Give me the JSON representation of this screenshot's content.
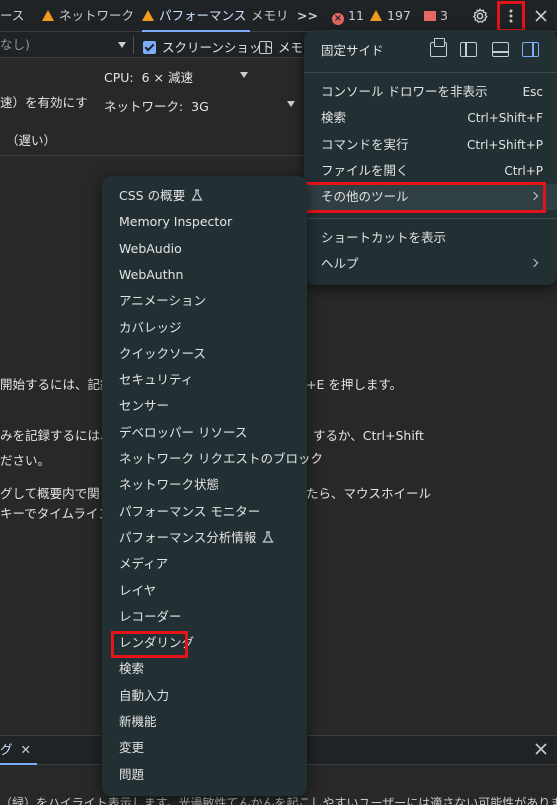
{
  "tabbar": {
    "tab_partial": "ース",
    "tab_network": "ネットワーク",
    "tab_performance": "パフォーマンス",
    "tab_memory": "メモリ",
    "more_tabs": ">>",
    "errors_count": "11",
    "warnings_count": "197",
    "issues_count": "3"
  },
  "toolbar": {
    "select_value": "なし)",
    "screenshot_label": "スクリーンショット",
    "memory_label": "メモリ"
  },
  "settings": {
    "left_text": "速）を有効にす",
    "cpu_label": "CPU:",
    "cpu_value": "6 × 減速",
    "network_label": "ネットワーク:",
    "network_value": "3G",
    "slow_text": "（遅い）"
  },
  "background_text": [
    "開始するには、記録",
    "+E を押します。",
    "みを記録するには、",
    "するか、Ctrl+Shift",
    "ださい。",
    "グして概要内で関",
    "たら、マウスホイール",
    "キーでタイムライン(",
    "（緑）をハイライト表示します。光過敏性てんかんを起こしやすいユーザーには適さない可能性があります"
  ],
  "drawer": {
    "tab_label": "グ",
    "close_label": "✕"
  },
  "main_menu": {
    "dock_side_label": "固定サイド",
    "items": [
      {
        "label": "コンソール ドロワーを非表示",
        "shortcut": "Esc"
      },
      {
        "label": "検索",
        "shortcut": "Ctrl+Shift+F"
      },
      {
        "label": "コマンドを実行",
        "shortcut": "Ctrl+Shift+P"
      },
      {
        "label": "ファイルを開く",
        "shortcut": "Ctrl+P"
      },
      {
        "label": "その他のツール",
        "shortcut": ""
      },
      {
        "label": "ショートカットを表示",
        "shortcut": ""
      },
      {
        "label": "ヘルプ",
        "shortcut": ""
      }
    ]
  },
  "submenu": {
    "items": [
      {
        "label": "CSS の概要",
        "experimental": true
      },
      {
        "label": "Memory Inspector",
        "experimental": false
      },
      {
        "label": "WebAudio",
        "experimental": false
      },
      {
        "label": "WebAuthn",
        "experimental": false
      },
      {
        "label": "アニメーション",
        "experimental": false
      },
      {
        "label": "カバレッジ",
        "experimental": false
      },
      {
        "label": "クイックソース",
        "experimental": false
      },
      {
        "label": "セキュリティ",
        "experimental": false
      },
      {
        "label": "センサー",
        "experimental": false
      },
      {
        "label": "デベロッパー リソース",
        "experimental": false
      },
      {
        "label": "ネットワーク リクエストのブロック",
        "experimental": false
      },
      {
        "label": "ネットワーク状態",
        "experimental": false
      },
      {
        "label": "パフォーマンス モニター",
        "experimental": false
      },
      {
        "label": "パフォーマンス分析情報",
        "experimental": true
      },
      {
        "label": "メディア",
        "experimental": false
      },
      {
        "label": "レイヤ",
        "experimental": false
      },
      {
        "label": "レコーダー",
        "experimental": false
      },
      {
        "label": "レンダリング",
        "experimental": false
      },
      {
        "label": "検索",
        "experimental": false
      },
      {
        "label": "自動入力",
        "experimental": false
      },
      {
        "label": "新機能",
        "experimental": false
      },
      {
        "label": "変更",
        "experimental": false
      },
      {
        "label": "問題",
        "experimental": false
      }
    ]
  },
  "colors": {
    "highlight_box": "#e5141a",
    "accent": "#7cacf8",
    "menu_bg": "#233033"
  }
}
